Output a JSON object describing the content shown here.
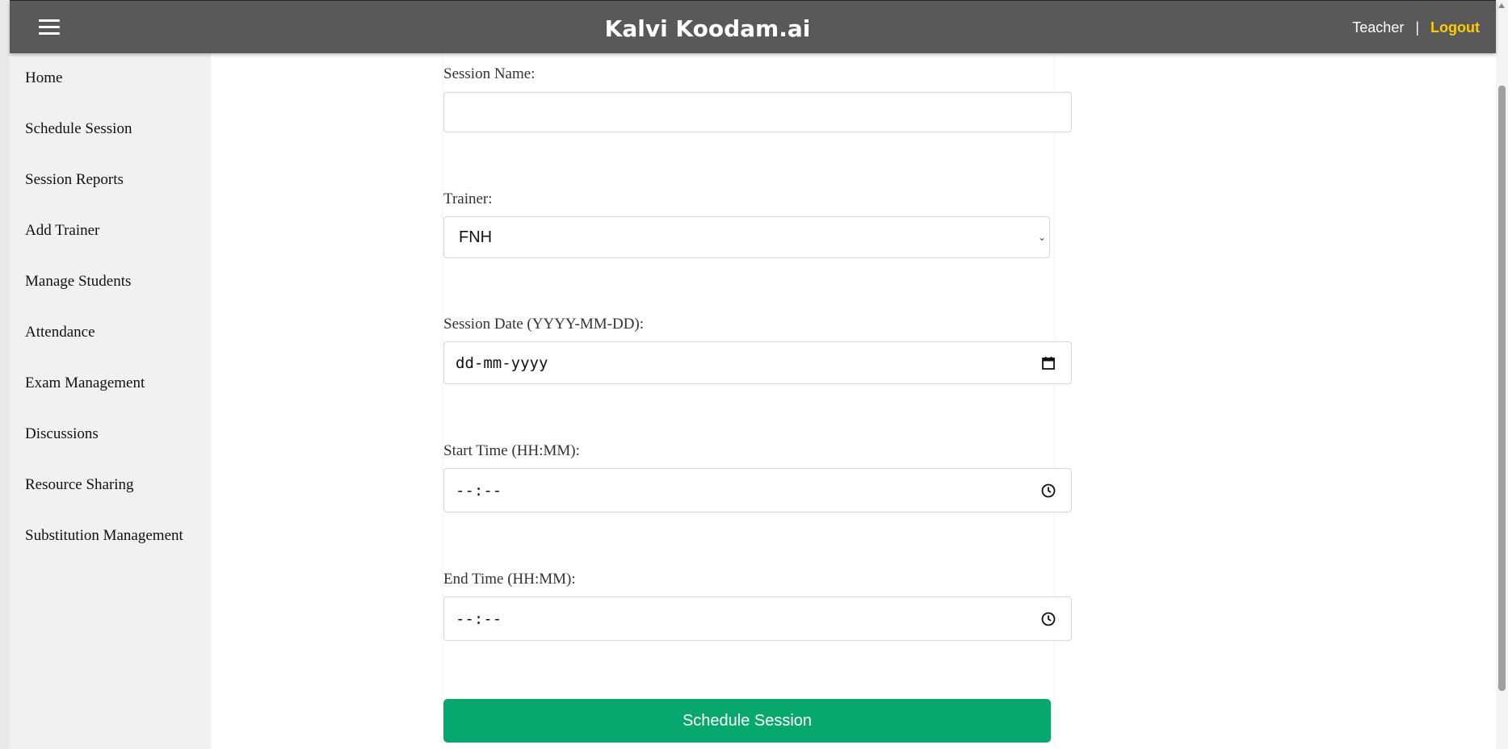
{
  "header": {
    "brand": "Kalvi Koodam.ai",
    "role": "Teacher",
    "separator": "|",
    "logout_label": "Logout"
  },
  "sidebar": {
    "items": [
      {
        "label": "Home"
      },
      {
        "label": "Schedule Session"
      },
      {
        "label": "Session Reports"
      },
      {
        "label": "Add Trainer"
      },
      {
        "label": "Manage Students"
      },
      {
        "label": "Attendance"
      },
      {
        "label": "Exam Management"
      },
      {
        "label": "Discussions"
      },
      {
        "label": "Resource Sharing"
      },
      {
        "label": "Substitution Management"
      }
    ]
  },
  "form": {
    "session_name": {
      "label": "Session Name:",
      "value": ""
    },
    "trainer": {
      "label": "Trainer:",
      "selected": "FNH"
    },
    "session_date": {
      "label": "Session Date (YYYY-MM-DD):",
      "placeholder": "dd-mm-yyyy"
    },
    "start_time": {
      "label": "Start Time (HH:MM):",
      "placeholder": "--:--"
    },
    "end_time": {
      "label": "End Time (HH:MM):",
      "placeholder": "--:--"
    },
    "submit_label": "Schedule Session"
  },
  "colors": {
    "topbar": "#595959",
    "logout": "#ffcc00",
    "submit": "#07a86d",
    "sidebar": "#f1f1f1"
  }
}
